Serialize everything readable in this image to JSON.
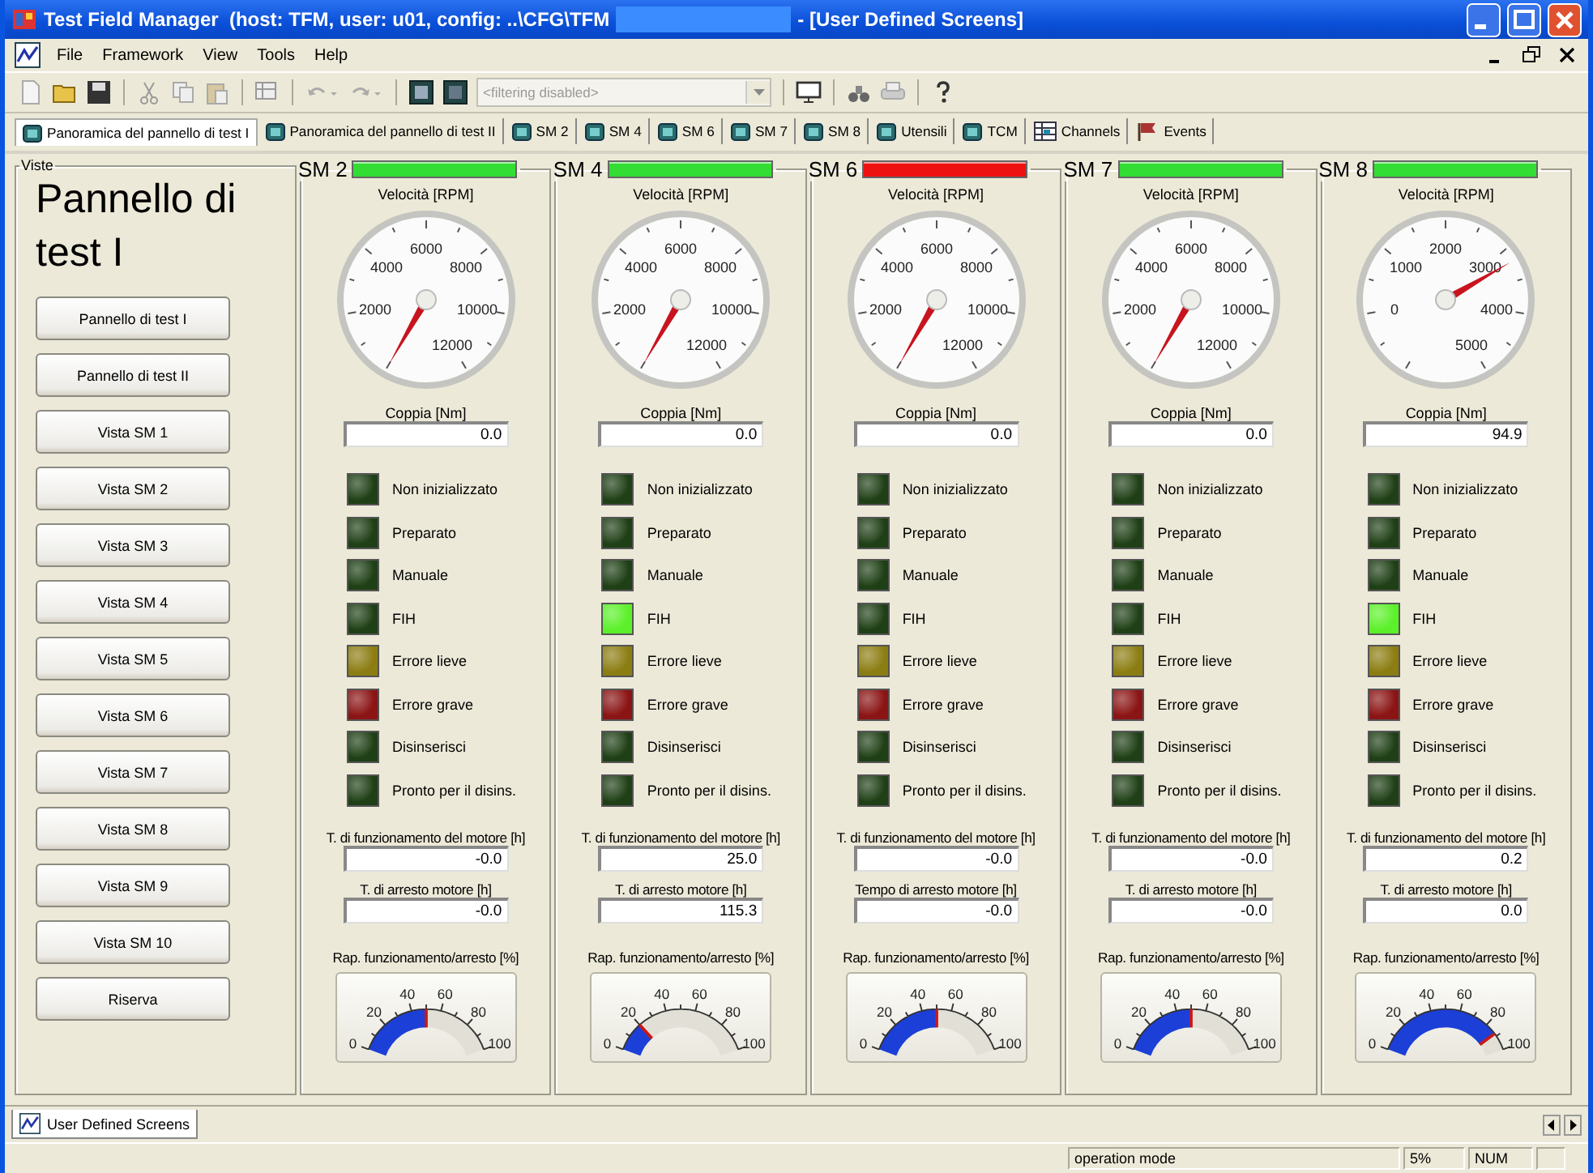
{
  "window": {
    "title": "Test Field Manager  (host: TFM, user: u01, config: ..\\CFG\\TFM",
    "title_suffix": "- [User Defined Screens]"
  },
  "menu": [
    "File",
    "Framework",
    "View",
    "Tools",
    "Help"
  ],
  "filter": {
    "value": "<filtering disabled>",
    "disabled": true
  },
  "tabs": [
    {
      "label": "Panoramica del pannello di test I",
      "selected": true,
      "kind": "screen"
    },
    {
      "label": "Panoramica del pannello di test II",
      "selected": false,
      "kind": "screen"
    },
    {
      "label": "SM 2",
      "selected": false,
      "kind": "screen"
    },
    {
      "label": "SM 4",
      "selected": false,
      "kind": "screen"
    },
    {
      "label": "SM 6",
      "selected": false,
      "kind": "screen"
    },
    {
      "label": "SM 7",
      "selected": false,
      "kind": "screen"
    },
    {
      "label": "SM 8",
      "selected": false,
      "kind": "screen"
    },
    {
      "label": "Utensili",
      "selected": false,
      "kind": "screen"
    },
    {
      "label": "TCM",
      "selected": false,
      "kind": "screen"
    },
    {
      "label": "Channels",
      "selected": false,
      "kind": "channels"
    },
    {
      "label": "Events",
      "selected": false,
      "kind": "events"
    }
  ],
  "views_panel": {
    "title": "Viste",
    "heading": "Pannello di test I",
    "buttons": [
      "Pannello di test I",
      "Pannello di test II",
      "Vista SM 1",
      "Vista SM 2",
      "Vista SM 3",
      "Vista SM 4",
      "Vista SM 5",
      "Vista SM 6",
      "Vista SM 7",
      "Vista SM 8",
      "Vista SM 9",
      "Vista SM 10",
      "Riserva"
    ]
  },
  "monitors": [
    {
      "name": "SM 2",
      "status": {
        "color": "#33dd33"
      },
      "speed_gauge": {
        "label": "Velocità [RPM]",
        "ticks": [
          "2000",
          "4000",
          "6000",
          "8000",
          "10000",
          "12000"
        ]
      },
      "torque_label": "Coppia [Nm]",
      "torque_value": "0.0",
      "leds": [
        {
          "label": "Non inizializzato",
          "color": "#1f4016"
        },
        {
          "label": "Preparato",
          "color": "#1f4016"
        },
        {
          "label": "Manuale",
          "color": "#1f4016"
        },
        {
          "label": "FIH",
          "color": "#1f4016"
        },
        {
          "label": "Errore lieve",
          "color": "#8c7d12"
        },
        {
          "label": "Errore grave",
          "color": "#8b1414"
        },
        {
          "label": "Disinserisci",
          "color": "#1f4016"
        },
        {
          "label": "Pronto per il disins.",
          "color": "#1f4016"
        }
      ],
      "run_label": "T. di funzionamento del motore [h]",
      "run_value": "-0.0",
      "stop_label": "T. di arresto motore [h]",
      "stop_value": "-0.0",
      "ratio_gauge": {
        "label": "Rap. funzionamento/arresto [%]",
        "ticks": [
          "0",
          "20",
          "40",
          "60",
          "80",
          "100"
        ],
        "level": 0.5
      }
    },
    {
      "name": "SM 4",
      "status": {
        "color": "#33dd33"
      },
      "speed_gauge": {
        "label": "Velocità [RPM]",
        "ticks": [
          "2000",
          "4000",
          "6000",
          "8000",
          "10000",
          "12000"
        ]
      },
      "torque_label": "Coppia [Nm]",
      "torque_value": "0.0",
      "leds": [
        {
          "label": "Non inizializzato",
          "color": "#1f4016"
        },
        {
          "label": "Preparato",
          "color": "#1f4016"
        },
        {
          "label": "Manuale",
          "color": "#1f4016"
        },
        {
          "label": "FIH",
          "color": "#5cf02a"
        },
        {
          "label": "Errore lieve",
          "color": "#8c7d12"
        },
        {
          "label": "Errore grave",
          "color": "#8b1414"
        },
        {
          "label": "Disinserisci",
          "color": "#1f4016"
        },
        {
          "label": "Pronto per il disins.",
          "color": "#1f4016"
        }
      ],
      "run_label": "T. di funzionamento del motore [h]",
      "run_value": "25.0",
      "stop_label": "T. di arresto motore [h]",
      "stop_value": "115.3",
      "ratio_gauge": {
        "label": "Rap. funzionamento/arresto [%]",
        "ticks": [
          "0",
          "20",
          "40",
          "60",
          "80",
          "100"
        ],
        "level": 0.2
      }
    },
    {
      "name": "SM 6",
      "status": {
        "color": "#ee1111"
      },
      "speed_gauge": {
        "label": "Velocità [RPM]",
        "ticks": [
          "2000",
          "4000",
          "6000",
          "8000",
          "10000",
          "12000"
        ]
      },
      "torque_label": "Coppia [Nm]",
      "torque_value": "0.0",
      "leds": [
        {
          "label": "Non inizializzato",
          "color": "#1f4016"
        },
        {
          "label": "Preparato",
          "color": "#1f4016"
        },
        {
          "label": "Manuale",
          "color": "#1f4016"
        },
        {
          "label": "FIH",
          "color": "#1f4016"
        },
        {
          "label": "Errore lieve",
          "color": "#8c7d12"
        },
        {
          "label": "Errore grave",
          "color": "#8b1414"
        },
        {
          "label": "Disinserisci",
          "color": "#1f4016"
        },
        {
          "label": "Pronto per il disins.",
          "color": "#1f4016"
        }
      ],
      "run_label": "T. di funzionamento del motore [h]",
      "run_value": "-0.0",
      "stop_label": "Tempo di arresto motore [h]",
      "stop_value": "-0.0",
      "ratio_gauge": {
        "label": "Rap. funzionamento/arresto [%]",
        "ticks": [
          "0",
          "20",
          "40",
          "60",
          "80",
          "100"
        ],
        "level": 0.5
      }
    },
    {
      "name": "SM 7",
      "status": {
        "color": "#33dd33"
      },
      "speed_gauge": {
        "label": "Velocità [RPM]",
        "ticks": [
          "2000",
          "4000",
          "6000",
          "8000",
          "10000",
          "12000"
        ]
      },
      "torque_label": "Coppia [Nm]",
      "torque_value": "0.0",
      "leds": [
        {
          "label": "Non inizializzato",
          "color": "#1f4016"
        },
        {
          "label": "Preparato",
          "color": "#1f4016"
        },
        {
          "label": "Manuale",
          "color": "#1f4016"
        },
        {
          "label": "FIH",
          "color": "#1f4016"
        },
        {
          "label": "Errore lieve",
          "color": "#8c7d12"
        },
        {
          "label": "Errore grave",
          "color": "#8b1414"
        },
        {
          "label": "Disinserisci",
          "color": "#1f4016"
        },
        {
          "label": "Pronto per il disins.",
          "color": "#1f4016"
        }
      ],
      "run_label": "T. di funzionamento del motore [h]",
      "run_value": "-0.0",
      "stop_label": "T. di arresto motore [h]",
      "stop_value": "-0.0",
      "ratio_gauge": {
        "label": "Rap. funzionamento/arresto [%]",
        "ticks": [
          "0",
          "20",
          "40",
          "60",
          "80",
          "100"
        ],
        "level": 0.5
      }
    },
    {
      "name": "SM 8",
      "status": {
        "color": "#33dd33"
      },
      "speed_gauge": {
        "label": "Velocità [RPM]",
        "ticks": [
          "0",
          "1000",
          "2000",
          "3000",
          "4000",
          "5000"
        ],
        "level": 0.7
      },
      "torque_label": "Coppia [Nm]",
      "torque_value": "94.9",
      "leds": [
        {
          "label": "Non inizializzato",
          "color": "#1f4016"
        },
        {
          "label": "Preparato",
          "color": "#1f4016"
        },
        {
          "label": "Manuale",
          "color": "#1f4016"
        },
        {
          "label": "FIH",
          "color": "#5cf02a"
        },
        {
          "label": "Errore lieve",
          "color": "#8c7d12"
        },
        {
          "label": "Errore grave",
          "color": "#8b1414"
        },
        {
          "label": "Disinserisci",
          "color": "#1f4016"
        },
        {
          "label": "Pronto per il disins.",
          "color": "#1f4016"
        }
      ],
      "run_label": "T. di funzionamento del motore [h]",
      "run_value": "0.2",
      "stop_label": "T. di arresto motore [h]",
      "stop_value": "0.0",
      "ratio_gauge": {
        "label": "Rap. funzionamento/arresto [%]",
        "ticks": [
          "0",
          "20",
          "40",
          "60",
          "80",
          "100"
        ],
        "level": 0.88
      }
    }
  ],
  "doc_tabs": [
    {
      "label": "User Defined Screens",
      "selected": true
    }
  ],
  "status_bar": [
    "operation mode",
    "5%",
    "NUM"
  ]
}
